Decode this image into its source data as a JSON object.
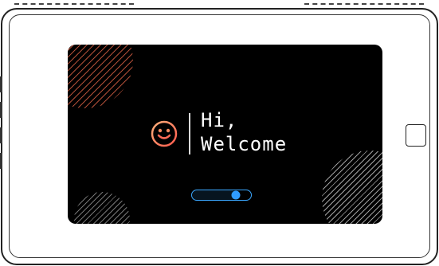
{
  "greeting": {
    "line1": "Hi,",
    "line2": "Welcome"
  },
  "icons": {
    "emoji": "smiley-face-icon"
  },
  "slider": {
    "value": 0.74
  },
  "colors": {
    "device_frame": "#222222",
    "screen_bg": "#000000",
    "accent": "#3aa7ff",
    "smiley_gradient_start": "#ffb07a",
    "smiley_gradient_end": "#ff5a4d"
  }
}
